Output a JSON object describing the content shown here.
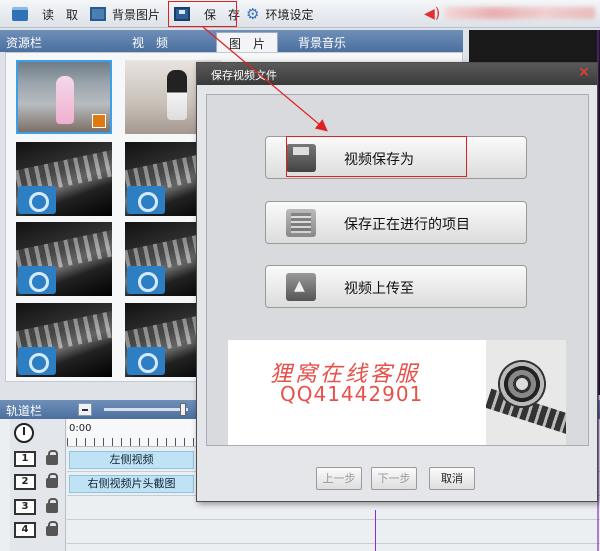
{
  "toolbar": {
    "read_label": "读　取",
    "bg_image_label": "背景图片",
    "save_label": "保　存",
    "env_label": "环境设定"
  },
  "resource": {
    "title": "资源栏",
    "tabs": [
      {
        "label": "视　频",
        "active": false
      },
      {
        "label": "图　片",
        "active": true
      },
      {
        "label": "背景音乐",
        "active": false
      }
    ]
  },
  "timeline": {
    "title": "轨道栏",
    "time_start": "0:00",
    "tracks": [
      {
        "number": "1",
        "clip": "左侧视频"
      },
      {
        "number": "2",
        "clip": "右侧视频片头截图"
      },
      {
        "number": "3",
        "clip": ""
      },
      {
        "number": "4",
        "clip": ""
      }
    ]
  },
  "dialog": {
    "title": "保存视频文件",
    "options": [
      {
        "label": "视频保存为",
        "icon": "floppy-icon"
      },
      {
        "label": "保存正在进行的项目",
        "icon": "project-icon"
      },
      {
        "label": "视频上传至",
        "icon": "upload-icon"
      }
    ],
    "promo_line1": "狸窝在线客服",
    "promo_line2": "QQ41442901",
    "prev_label": "上一步",
    "next_label": "下一步",
    "cancel_label": "取消"
  },
  "colors": {
    "accent_blue": "#4b6f9e",
    "highlight_red": "#e02020",
    "promo_red": "#e8504a"
  }
}
